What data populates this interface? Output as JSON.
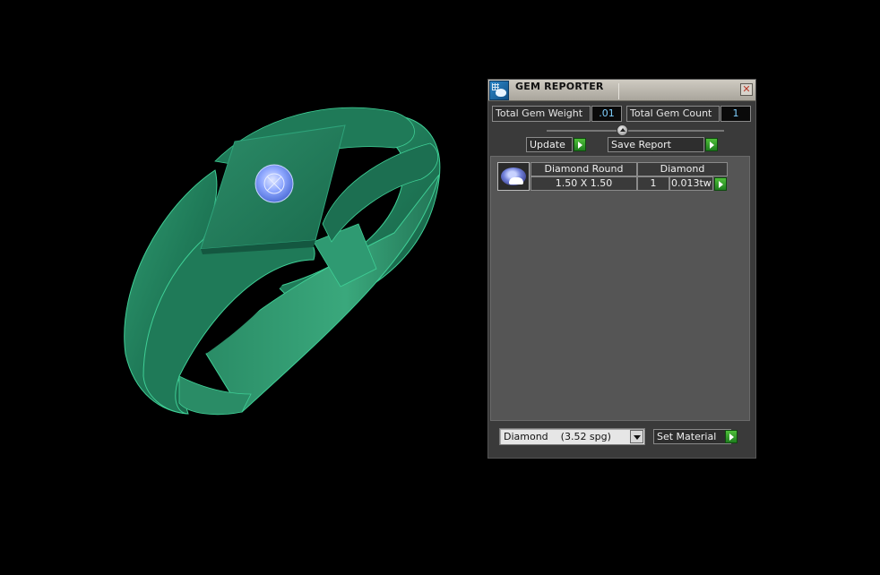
{
  "panel": {
    "title": "GEM REPORTER",
    "close_glyph": "✕",
    "total_gem_weight_label": "Total Gem Weight",
    "total_gem_weight_value": ".01",
    "total_gem_count_label": "Total Gem Count",
    "total_gem_count_value": "1",
    "update_label": "Update",
    "save_report_label": "Save Report",
    "gem_rows": [
      {
        "shape": "Diamond Round",
        "material": "Diamond",
        "size": "1.50 X 1.50",
        "count": "1",
        "weight": "0.013tw"
      }
    ],
    "material_select": {
      "value": "Diamond    (3.52 spg)"
    },
    "set_material_label": "Set Material"
  },
  "colors": {
    "ring": "#1f7a58",
    "gem": "#7fa6ff",
    "accent_green": "#3aa62e"
  },
  "icons": [
    "gem-reporter-icon",
    "close-icon",
    "arrow-right-icon",
    "chevron-down-icon"
  ]
}
